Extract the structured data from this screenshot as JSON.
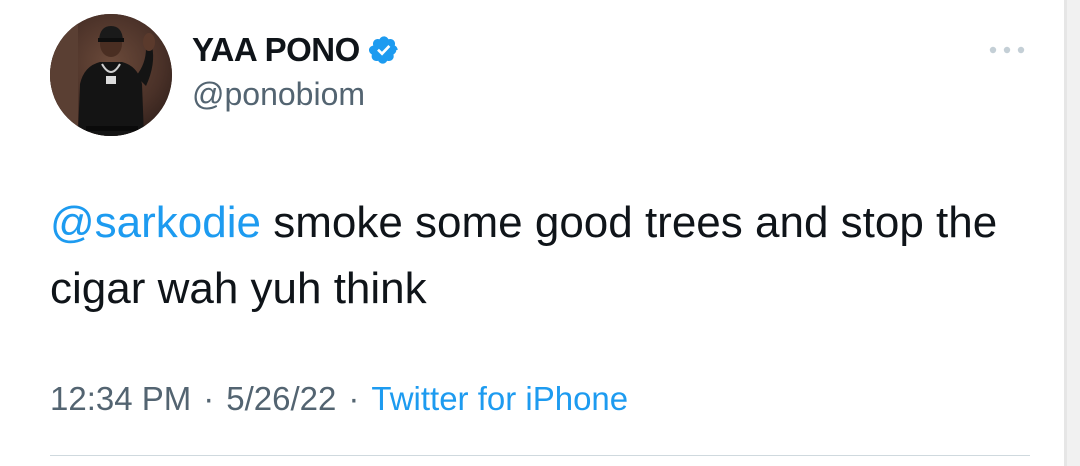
{
  "tweet": {
    "display_name": "YAA PONO",
    "handle": "@ponobiom",
    "text_mention": "@sarkodie",
    "text_body": " smoke some good trees and stop the cigar wah yuh think",
    "time": "12:34 PM",
    "date": "5/26/22",
    "source": "Twitter for iPhone",
    "separator": "·",
    "verified_icon": "verified-badge-icon",
    "more_icon": "more-options-icon"
  },
  "colors": {
    "accent": "#1d9bf0",
    "text": "#0f1419",
    "secondary": "#536471",
    "divider": "#cfd9de"
  }
}
